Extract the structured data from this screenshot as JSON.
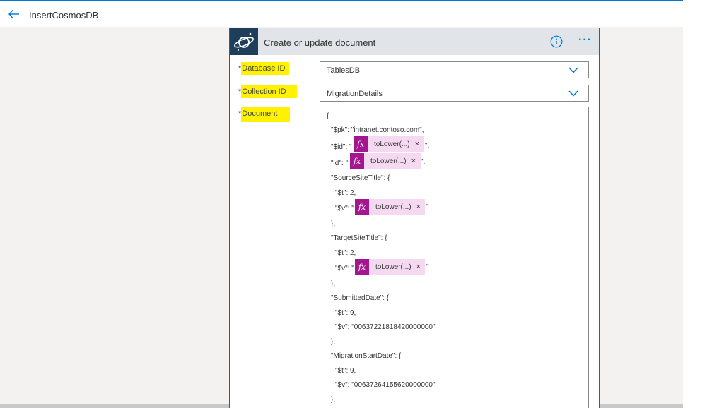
{
  "header": {
    "title": "InsertCosmosDB"
  },
  "card": {
    "title": "Create or update document",
    "more_label": "···"
  },
  "fields": {
    "database": {
      "label": "Database ID",
      "value": "TablesDB"
    },
    "collection": {
      "label": "Collection ID",
      "value": "MigrationDetails"
    },
    "document": {
      "label": "Document"
    }
  },
  "required_marker": "*",
  "doc_lines": [
    "{",
    "\"$pk\": \"intranet.contoso.com\",",
    "\"$id\": \"",
    "\",",
    "\"id\": \"",
    "\",",
    "\"SourceSiteTitle\": {",
    "\"$t\": 2,",
    "\"$v\": \"",
    "\"",
    "},",
    "\"TargetSiteTitle\": {",
    "\"$t\": 2,",
    "\"$v\": \"",
    "\"",
    "},",
    "\"SubmittedDate\": {",
    "\"$t\": 9,",
    "\"$v\": \"00637221818420000000\"",
    "},",
    "\"MigrationStartDate\": {",
    "\"$t\": 9,",
    "\"$v\": \"00637264155620000000\"",
    "},"
  ],
  "tokens": [
    {
      "fx": "fx",
      "label": "toLower(...)",
      "close": "×"
    },
    {
      "fx": "fx",
      "label": "toLower(...)",
      "close": "×"
    },
    {
      "fx": "fx",
      "label": "toLower(...)",
      "close": "×"
    },
    {
      "fx": "fx",
      "label": "toLower(...)",
      "close": "×"
    }
  ],
  "colors": {
    "accent": "#0078d4",
    "highlight": "#fff200",
    "token_bg": "#f5d9f1",
    "token_fx": "#a4168f",
    "card_icon_bg": "#1f3e5c"
  },
  "icons": {
    "back": "arrow-left-icon",
    "connector": "cosmos-planet-icon",
    "info": "info-icon",
    "chevron": "chevron-down-icon"
  }
}
